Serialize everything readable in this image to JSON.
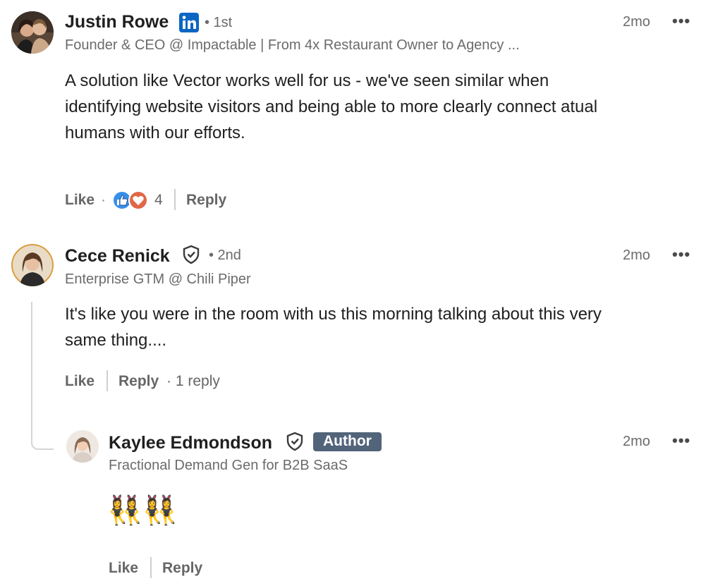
{
  "comments": [
    {
      "name": "Justin Rowe",
      "degree": "• 1st",
      "headline": "Founder & CEO @ Impactable | From 4x Restaurant Owner to Agency ...",
      "time": "2mo",
      "more": "•••",
      "text_lines": [
        "A solution like Vector works well for us - we've seen similar when",
        "identifying website visitors and being able to more clearly connect atual",
        "humans with our efforts."
      ],
      "like": "Like",
      "like_sep": "·",
      "reaction_count": "4",
      "reply": "Reply",
      "badge_icon": "linkedin-icon",
      "reactions": [
        "thumbs-up-icon",
        "heart-icon"
      ]
    },
    {
      "name": "Cece Renick",
      "degree": "• 2nd",
      "headline": "Enterprise GTM @ Chili Piper",
      "time": "2mo",
      "more": "•••",
      "text_lines": [
        "It's like you were in the room with us this morning talking about this very",
        "same thing...."
      ],
      "like": "Like",
      "reply": "Reply",
      "replies": "· 1 reply",
      "badge_icon": "verified-shield-icon"
    },
    {
      "name": "Kaylee Edmondson",
      "author_badge": "Author",
      "headline": "Fractional Demand Gen for B2B SaaS",
      "time": "2mo",
      "more": "•••",
      "emoji": "👯‍♀️👯‍♀️",
      "like": "Like",
      "reply": "Reply",
      "badge_icon": "verified-shield-icon"
    }
  ],
  "colors": {
    "linkedin_blue": "#0a66c2",
    "author_badge_bg": "#52647a",
    "muted_text": "#6b6b6b",
    "heart_red": "#e06847",
    "like_blue": "#378fe9"
  }
}
